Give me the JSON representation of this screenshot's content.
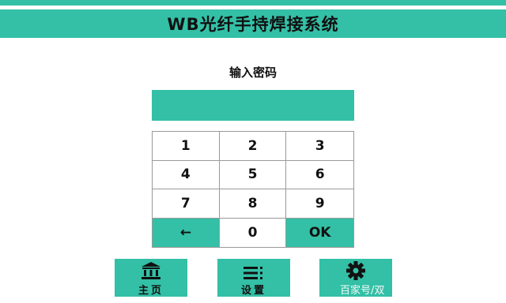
{
  "header": {
    "title": "WB光纤手持焊接系统"
  },
  "prompt": {
    "label": "输入密码"
  },
  "password_display": {
    "value": ""
  },
  "keypad": {
    "keys": [
      "1",
      "2",
      "3",
      "4",
      "5",
      "6",
      "7",
      "8",
      "9",
      "←",
      "0",
      "OK"
    ]
  },
  "nav": {
    "home_label": "主页",
    "home_icon": "bank-icon",
    "settings_label": "设置",
    "settings_icon": "menu-icon",
    "gear_icon": "gear-icon"
  },
  "watermark": {
    "text": "百家号/双"
  },
  "colors": {
    "accent": "#33c0a6",
    "background": "#ffffff",
    "border": "#9a9a9a"
  }
}
